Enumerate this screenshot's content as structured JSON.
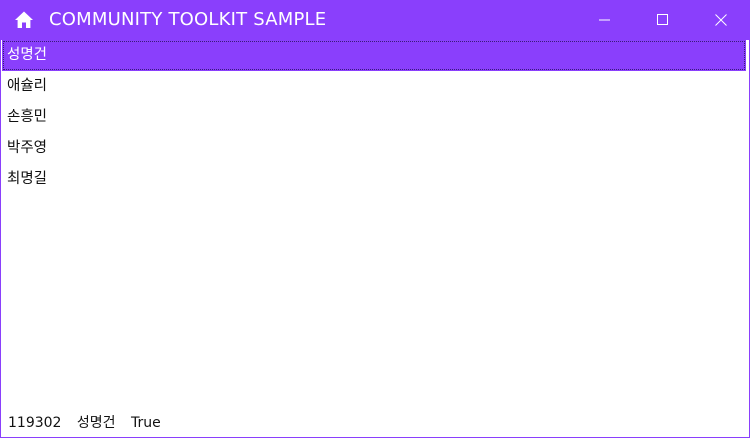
{
  "window": {
    "title": "COMMUNITY TOOLKIT SAMPLE",
    "accent_color": "#8a3ffc",
    "icons": {
      "home": "home-icon",
      "minimize": "minimize-icon",
      "maximize": "maximize-icon",
      "close": "close-icon"
    }
  },
  "list": {
    "items": [
      {
        "label": "성명건",
        "selected": true
      },
      {
        "label": "애슐리",
        "selected": false
      },
      {
        "label": "손흥민",
        "selected": false
      },
      {
        "label": "박주영",
        "selected": false
      },
      {
        "label": "최명길",
        "selected": false
      }
    ]
  },
  "status": {
    "id": "119302",
    "name": "성명건",
    "flag": "True"
  }
}
